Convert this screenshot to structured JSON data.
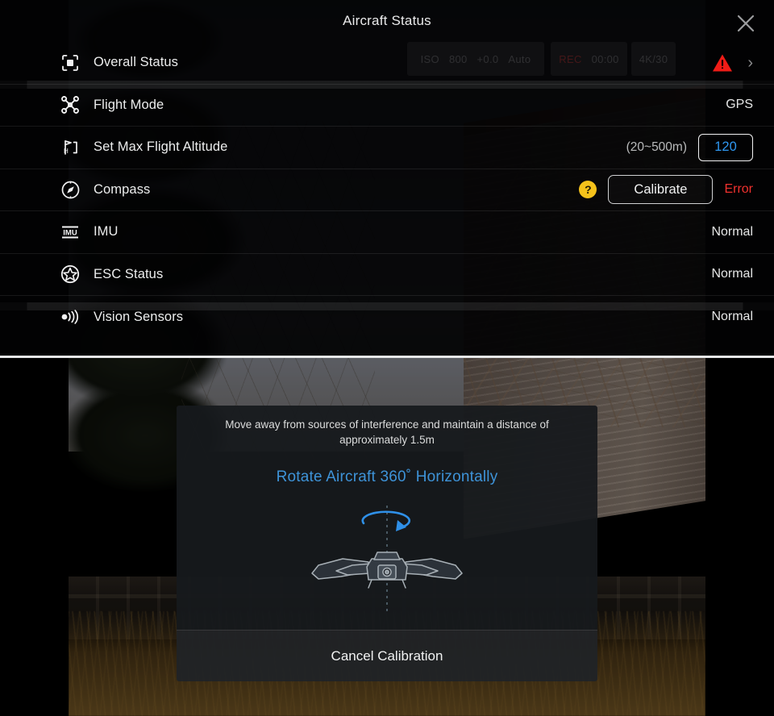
{
  "header": {
    "title": "Aircraft Status",
    "close_icon": "close-icon"
  },
  "status_rows": [
    {
      "icon": "overall-status-icon",
      "label": "Overall Status",
      "value": "",
      "warning_icon": "warning-triangle-icon",
      "chevron": "›"
    },
    {
      "icon": "drone-icon",
      "label": "Flight Mode",
      "value": "GPS"
    },
    {
      "icon": "altitude-icon",
      "label": "Set Max Flight Altitude",
      "hint": "(20~500m)",
      "input_value": "120"
    },
    {
      "icon": "compass-icon",
      "label": "Compass",
      "help_icon": "help-question-icon",
      "help_glyph": "?",
      "button_label": "Calibrate",
      "status": "Error"
    },
    {
      "icon": "imu-icon",
      "label": "IMU",
      "value": "Normal"
    },
    {
      "icon": "esc-icon",
      "label": "ESC Status",
      "value": "Normal"
    },
    {
      "icon": "vision-sensor-icon",
      "label": "Vision Sensors",
      "value": "Normal"
    }
  ],
  "hud": {
    "chip_a": [
      "ISO",
      "800",
      "+0.0",
      "Auto"
    ],
    "chip_b": [
      "REC",
      "00:00"
    ],
    "chip_c": [
      "4K/30"
    ]
  },
  "calibration": {
    "instruction": "Move away from sources of interference and maintain a distance of approximately 1.5m",
    "action": "Rotate Aircraft 360˚ Horizontally",
    "illustration_icon": "drone-rotation-illustration",
    "cancel_label": "Cancel Calibration"
  },
  "colors": {
    "accent_blue": "#3e93d8",
    "input_blue": "#2f97f0",
    "error_red": "#f0312e",
    "warning_yellow": "#f5c21b",
    "panel_bg": "#020203",
    "text_primary": "#eceded"
  }
}
